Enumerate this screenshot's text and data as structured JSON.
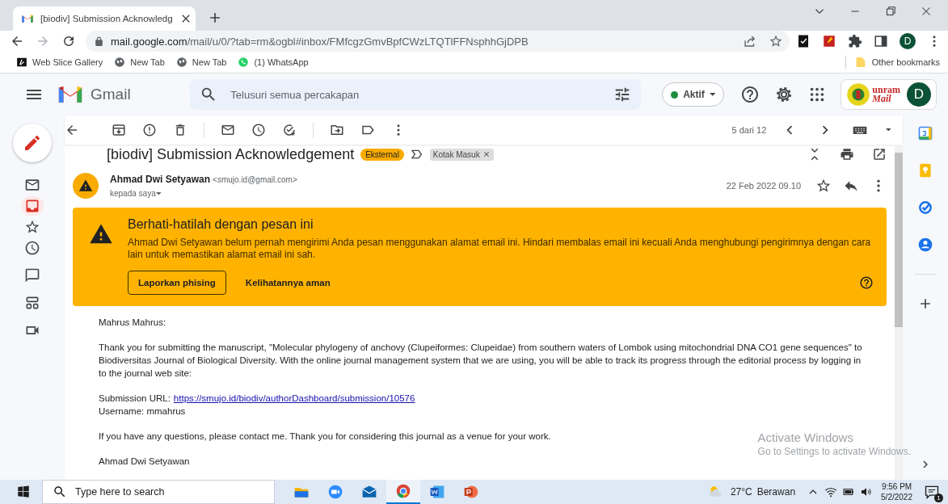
{
  "browser": {
    "tab_title": "[biodiv] Submission Acknowledg",
    "address_host": "mail.google.com",
    "address_path": "/mail/u/0/?tab=rm&ogbl#inbox/FMfcgzGmvBpfCWzLTQTlFFNsphhGjDPB",
    "profile_initial": "D",
    "bookmarks": [
      {
        "text": "Web Slice Gallery",
        "kind": "slice"
      },
      {
        "text": "New Tab",
        "kind": "globe"
      },
      {
        "text": "New Tab",
        "kind": "globe"
      },
      {
        "text": "(1) WhatsApp",
        "kind": "whatsapp"
      }
    ],
    "other_bookmarks": "Other bookmarks"
  },
  "gmail": {
    "app_name": "Gmail",
    "search": {
      "placeholder": "Telusuri semua percakapan"
    },
    "status": "Aktif",
    "account_initial": "D",
    "org_logo_top": "unram",
    "org_logo_bottom": "Mail"
  },
  "nav": [
    {
      "kind": "mail",
      "selected": false
    },
    {
      "kind": "inbox",
      "selected": true
    },
    {
      "kind": "star",
      "selected": false
    },
    {
      "kind": "clock",
      "selected": false
    },
    {
      "kind": "chat",
      "selected": false
    },
    {
      "kind": "spaces",
      "selected": false
    },
    {
      "kind": "meet",
      "selected": false
    }
  ],
  "toolbar": {
    "counter": "5 dari 12"
  },
  "message": {
    "subject": "[biodiv] Submission Acknowledgement",
    "labels": [
      {
        "text": "Eksternal",
        "kind": "external"
      },
      {
        "text": "Kotak Masuk",
        "kind": "folder"
      }
    ],
    "sender_name": "Ahmad Dwi Setyawan",
    "sender_email": "<smujo.id@gmail.com>",
    "recipient": "kepada saya",
    "date": "22 Feb 2022 09.10",
    "warning": {
      "title": "Berhati-hatilah dengan pesan ini",
      "text": "Ahmad Dwi Setyawan belum pernah mengirimi Anda pesan menggunakan alamat email ini. Hindari membalas email ini kecuali Anda menghubungi pengirimnya dengan cara lain untuk memastikan alamat email ini sah.",
      "report_button": "Laporkan phising",
      "safe_button": "Kelihatannya aman"
    },
    "body": [
      [
        {
          "text": "Mahrus Mahrus:"
        }
      ],
      [
        {
          "text": "Thank you for submitting the manuscript, \"Molecular phylogeny of anchovy (Clupeiformes: Clupeidae) from southern waters of Lombok using mitochondrial DNA CO1 gene sequences\" to Biodiversitas Journal of Biological Diversity. With the online journal management system that we are using, you will be able to track its progress through the editorial process by logging in to the journal web site:"
        }
      ],
      [
        {
          "text": "Submission URL:",
          "link": "https://smujo.id/biodiv/authorDashboard/submission/10576"
        },
        {
          "text": "Username: mmahrus"
        }
      ],
      [
        {
          "text": "If you have any questions, please contact me. Thank you for considering this journal as a venue for your work."
        }
      ],
      [
        {
          "text": "Ahmad Dwi Setyawan"
        }
      ]
    ]
  },
  "os": {
    "watermark_title": "Activate Windows",
    "watermark_text": "Go to Settings to activate Windows.",
    "search_placeholder": "Type here to search",
    "temperature": "27°C",
    "weather": "Berawan",
    "time": "9:56 PM",
    "date": "5/2/2022",
    "notification_count": "1"
  }
}
